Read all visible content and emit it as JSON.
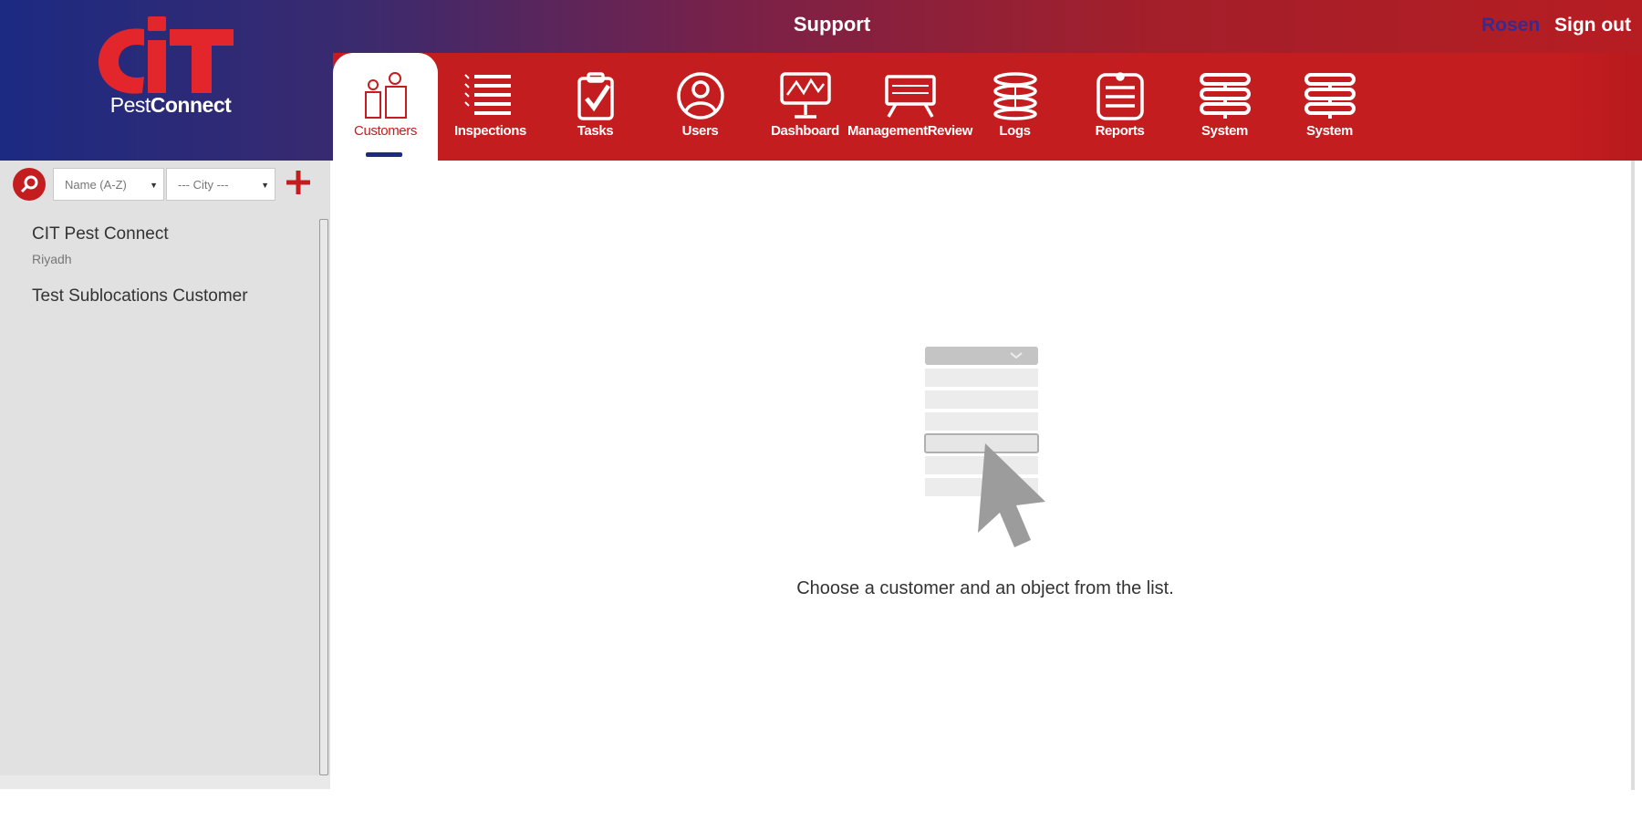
{
  "app": {
    "page_title": "Support",
    "logo_text_light": "Pest",
    "logo_text_bold": "Connect",
    "logo_letters": "CIT"
  },
  "user": {
    "name": "Rosen",
    "signout_label": "Sign out"
  },
  "nav": {
    "items": [
      {
        "label": "Customers",
        "icon": "customers-icon",
        "active": true
      },
      {
        "label": "Inspections",
        "icon": "inspections-list-icon",
        "active": false
      },
      {
        "label": "Tasks",
        "icon": "tasks-clipboard-icon",
        "active": false
      },
      {
        "label": "Users",
        "icon": "users-icon",
        "active": false
      },
      {
        "label": "Dashboard",
        "icon": "dashboard-icon",
        "active": false
      },
      {
        "label": "ManagementReview",
        "icon": "management-review-icon",
        "active": false
      },
      {
        "label": "Logs",
        "icon": "logs-stack-icon",
        "active": false
      },
      {
        "label": "Reports",
        "icon": "reports-icon",
        "active": false
      },
      {
        "label": "System",
        "icon": "system-icon",
        "active": false
      },
      {
        "label": "System",
        "icon": "system-icon",
        "active": false
      }
    ]
  },
  "sidebar": {
    "sort_select": "Name (A-Z)",
    "city_select": "--- City ---",
    "customers": [
      {
        "name": "CIT Pest Connect",
        "city": "Riyadh"
      },
      {
        "name": "Test Sublocations Customer",
        "city": ""
      }
    ]
  },
  "main": {
    "empty_hint": "Choose a customer and an object from the list."
  },
  "colors": {
    "brand_red": "#c41d1f",
    "brand_blue": "#1c2a82",
    "sidebar_bg": "#e1e1e1"
  }
}
